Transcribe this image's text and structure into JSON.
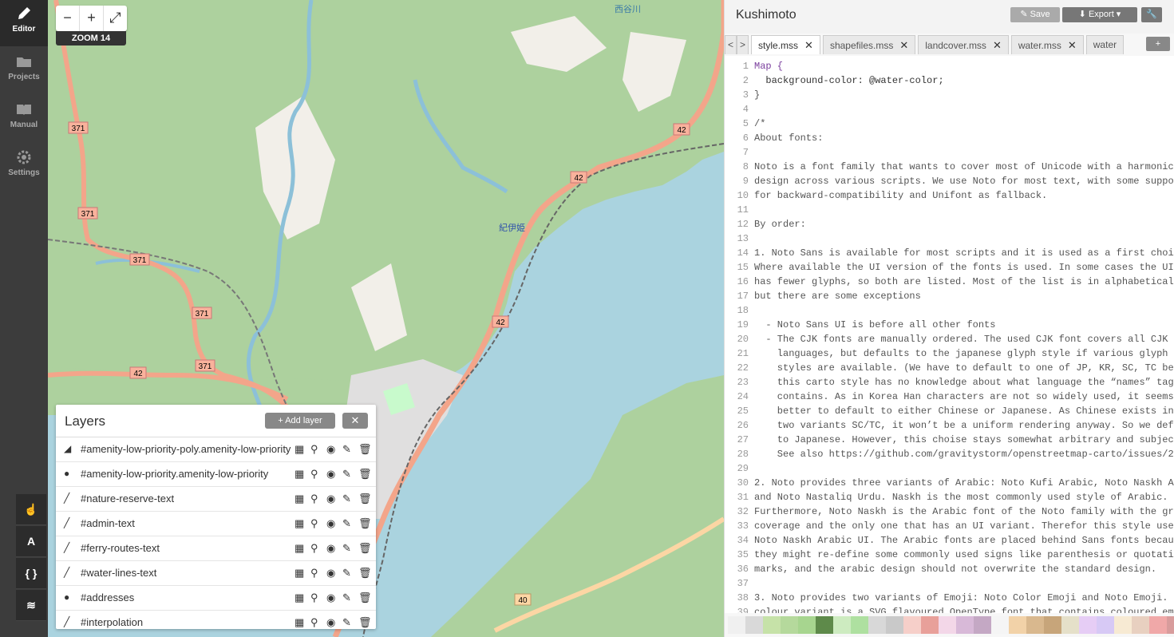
{
  "nav": {
    "items": [
      {
        "label": "Editor",
        "icon": "pencil-icon"
      },
      {
        "label": "Projects",
        "icon": "folder-icon"
      },
      {
        "label": "Manual",
        "icon": "book-icon"
      },
      {
        "label": "Settings",
        "icon": "gear-icon"
      }
    ],
    "tools": [
      {
        "label": "☝",
        "icon": "hand-pointer-icon"
      },
      {
        "label": "A",
        "icon": "text-icon"
      },
      {
        "label": "{ }",
        "icon": "braces-icon"
      },
      {
        "label": "≋",
        "icon": "layers-icon"
      }
    ]
  },
  "map": {
    "zoom_minus": "−",
    "zoom_plus": "+",
    "fullscreen": "⤢",
    "zoom_label": "ZOOM 14",
    "labels": {
      "r371a": "371",
      "r371b": "371",
      "r371c": "371",
      "r371d": "371",
      "r371e": "371",
      "r42a": "42",
      "r42b": "42",
      "r42c": "42",
      "r42d": "42",
      "r40": "40",
      "station": "紀伊姫",
      "place1": "西谷川"
    }
  },
  "layers": {
    "title": "Layers",
    "add_label": "Add layer",
    "close_label": "✕",
    "rows": [
      {
        "geom": "◢",
        "name": "#amenity-low-priority-poly.amenity-low-priority"
      },
      {
        "geom": "●",
        "name": "#amenity-low-priority.amenity-low-priority"
      },
      {
        "geom": "╱",
        "name": "#nature-reserve-text"
      },
      {
        "geom": "╱",
        "name": "#admin-text"
      },
      {
        "geom": "╱",
        "name": "#ferry-routes-text"
      },
      {
        "geom": "╱",
        "name": "#water-lines-text"
      },
      {
        "geom": "●",
        "name": "#addresses"
      },
      {
        "geom": "╱",
        "name": "#interpolation"
      }
    ]
  },
  "editor": {
    "title": "Kushimoto",
    "save_label": "Save",
    "export_label": "Export",
    "tabs": [
      "style.mss",
      "shapefiles.mss",
      "landcover.mss",
      "water.mss",
      "water"
    ],
    "add_tab": "+",
    "prev_tab": "<",
    "next_tab": ">",
    "code_lines": [
      "Map {",
      "  background-color: @water-color;",
      "}",
      "",
      "/*",
      "About fonts:",
      "",
      "Noto is a font family that wants to cover most of Unicode with a harmonic",
      "design across various scripts. We use Noto for most text, with some suppo",
      "for backward-compatibility and Unifont as fallback.",
      "",
      "By order:",
      "",
      "1. Noto Sans is available for most scripts and it is used as a first choi",
      "Where available the UI version of the fonts is used. In some cases the UI",
      "has fewer glyphs, so both are listed. Most of the list is in alphabetical",
      "but there are some exceptions",
      "",
      "  - Noto Sans UI is before all other fonts",
      "  - The CJK fonts are manually ordered. The used CJK font covers all CJK",
      "    languages, but defaults to the japanese glyph style if various glyph",
      "    styles are available. (We have to default to one of JP, KR, SC, TC be",
      "    this carto style has no knowledge about what language the “names” tag",
      "    contains. As in Korea Han characters are not so widely used, it seems",
      "    better to default to either Chinese or Japanese. As Chinese exists in",
      "    two variants SC/TC, it won’t be a uniform rendering anyway. So we def",
      "    to Japanese. However, this choise stays somewhat arbitrary and subjec",
      "    See also https://github.com/gravitystorm/openstreetmap-carto/issues/2",
      "",
      "2. Noto provides three variants of Arabic: Noto Kufi Arabic, Noto Naskh A",
      "and Noto Nastaliq Urdu. Naskh is the most commonly used style of Arabic.",
      "Furthermore, Noto Naskh is the Arabic font of the Noto family with the gr",
      "coverage and the only one that has an UI variant. Therefor this style use",
      "Noto Naskh Arabic UI. The Arabic fonts are placed behind Sans fonts becau",
      "they might re-define some commonly used signs like parenthesis or quotati",
      "marks, and the arabic design should not overwrite the standard design.",
      "",
      "3. Noto provides two variants of Emoji: Noto Color Emoji and Noto Emoji.",
      "colour variant is a SVG flavoured OpenType font that contains coloured em"
    ],
    "palette": [
      "#f0f0f0",
      "#d9d9d9",
      "#c6e2a8",
      "#b5d99c",
      "#a7d58f",
      "#5e8a4a",
      "#cdebc0",
      "#aee0a0",
      "#d8d8d8",
      "#c9c9c9",
      "#f6cfc9",
      "#e8a09a",
      "#f3d7e8",
      "#d8b9d8",
      "#c4a8c4",
      "#f5f5f5",
      "#f2d2a8",
      "#d9b88e",
      "#c7a57a",
      "#e5e0c9",
      "#e6cdf5",
      "#d7c9f5",
      "#f7ead3",
      "#e8d0c0",
      "#f0a8a8",
      "#d89c9c",
      "#f2dcc8"
    ]
  }
}
